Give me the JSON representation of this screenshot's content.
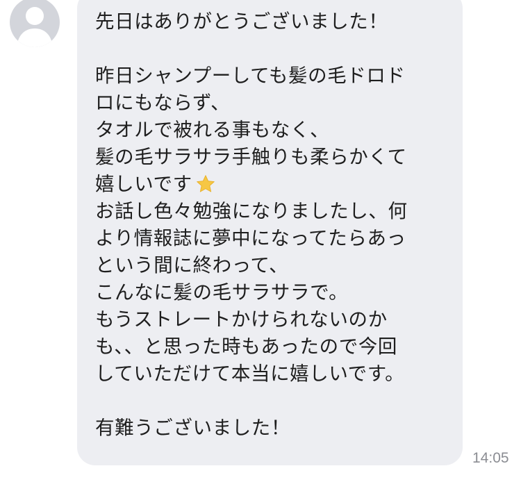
{
  "message": {
    "lines": [
      "先日はありがとうございました！",
      "",
      "昨日シャンプーしても髪の毛ドロド",
      "ロにもならず、",
      "タオルで被れる事もなく、",
      "髪の毛サラサラ手触りも柔らかくて",
      "嬉しいです",
      "お話し色々勉強になりましたし、何",
      "より情報誌に夢中になってたらあっ",
      "という間に終わって、",
      "こんなに髪の毛サラサラで。",
      "もうストレートかけられないのか",
      "も、、と思った時もあったので今回",
      "していただけて本当に嬉しいです。",
      "",
      "有難うございました！"
    ],
    "emoji_icon": "star-icon",
    "time": "14:05"
  },
  "colors": {
    "bubble": "#edeef2",
    "text": "#1e1e1e",
    "timestamp": "#8b8d93",
    "avatar_bg": "#d3d5db",
    "star": "#f6c744"
  }
}
